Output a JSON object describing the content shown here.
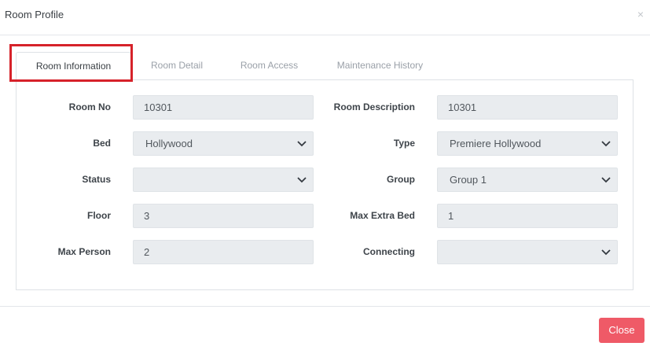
{
  "modal": {
    "title": "Room Profile",
    "close_icon": "close-icon",
    "close_glyph": "×"
  },
  "tabs": [
    {
      "label": "Room Information",
      "active": true
    },
    {
      "label": "Room Detail",
      "active": false
    },
    {
      "label": "Room Access",
      "active": false
    },
    {
      "label": "Maintenance History",
      "active": false
    }
  ],
  "form": {
    "room_no": {
      "label": "Room No",
      "value": "10301"
    },
    "room_description": {
      "label": "Room Description",
      "value": "10301"
    },
    "bed": {
      "label": "Bed",
      "value": "Hollywood"
    },
    "type": {
      "label": "Type",
      "value": "Premiere Hollywood"
    },
    "status": {
      "label": "Status",
      "value": ""
    },
    "group": {
      "label": "Group",
      "value": "Group 1"
    },
    "floor": {
      "label": "Floor",
      "value": "3"
    },
    "max_extra_bed": {
      "label": "Max Extra Bed",
      "value": "1"
    },
    "max_person": {
      "label": "Max Person",
      "value": "2"
    },
    "connecting": {
      "label": "Connecting",
      "value": ""
    }
  },
  "footer": {
    "close_label": "Close"
  },
  "colors": {
    "highlight": "#d6222a",
    "close_button": "#ef5a67",
    "field_bg": "#e9ecef"
  }
}
